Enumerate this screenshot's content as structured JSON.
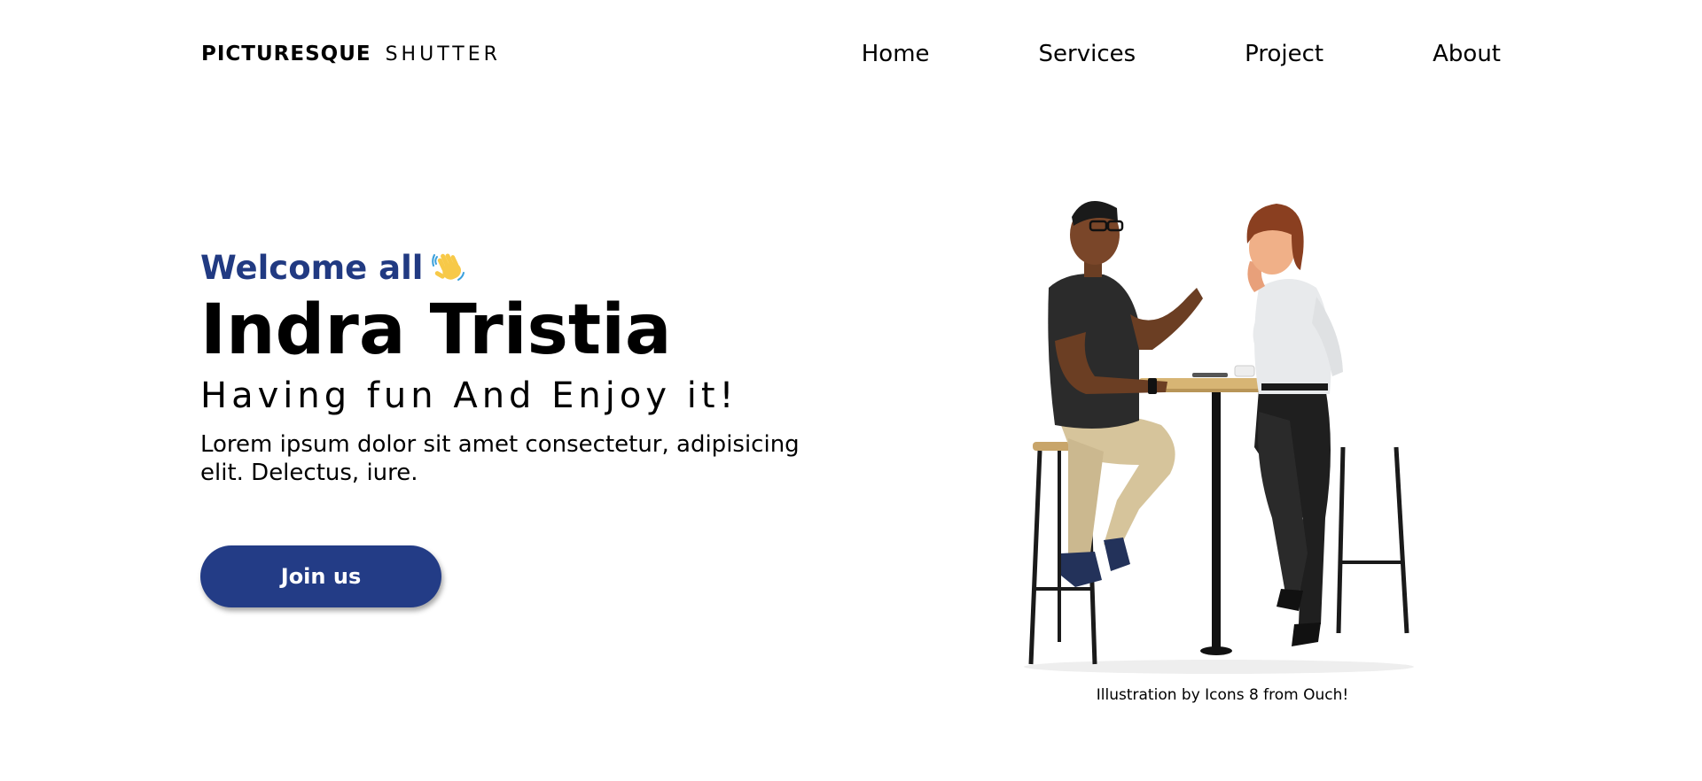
{
  "nav": {
    "logo_bold": "PICTURESQUE",
    "logo_light": "SHUTTER",
    "items": [
      {
        "label": "Home"
      },
      {
        "label": "Services"
      },
      {
        "label": "Project"
      },
      {
        "label": "About"
      }
    ]
  },
  "hero": {
    "welcome": "Welcome all",
    "wave_icon": "waving-hand-icon",
    "name": "Indra Tristia",
    "tagline": "Having fun And Enjoy it!",
    "description": "Lorem ipsum dolor sit amet consectetur, adipisicing elit. Delectus, iure.",
    "cta_label": "Join us"
  },
  "illustration": {
    "credit": "Illustration by Icons 8 from Ouch!"
  },
  "colors": {
    "accent": "#213a82",
    "button": "#233c86"
  }
}
